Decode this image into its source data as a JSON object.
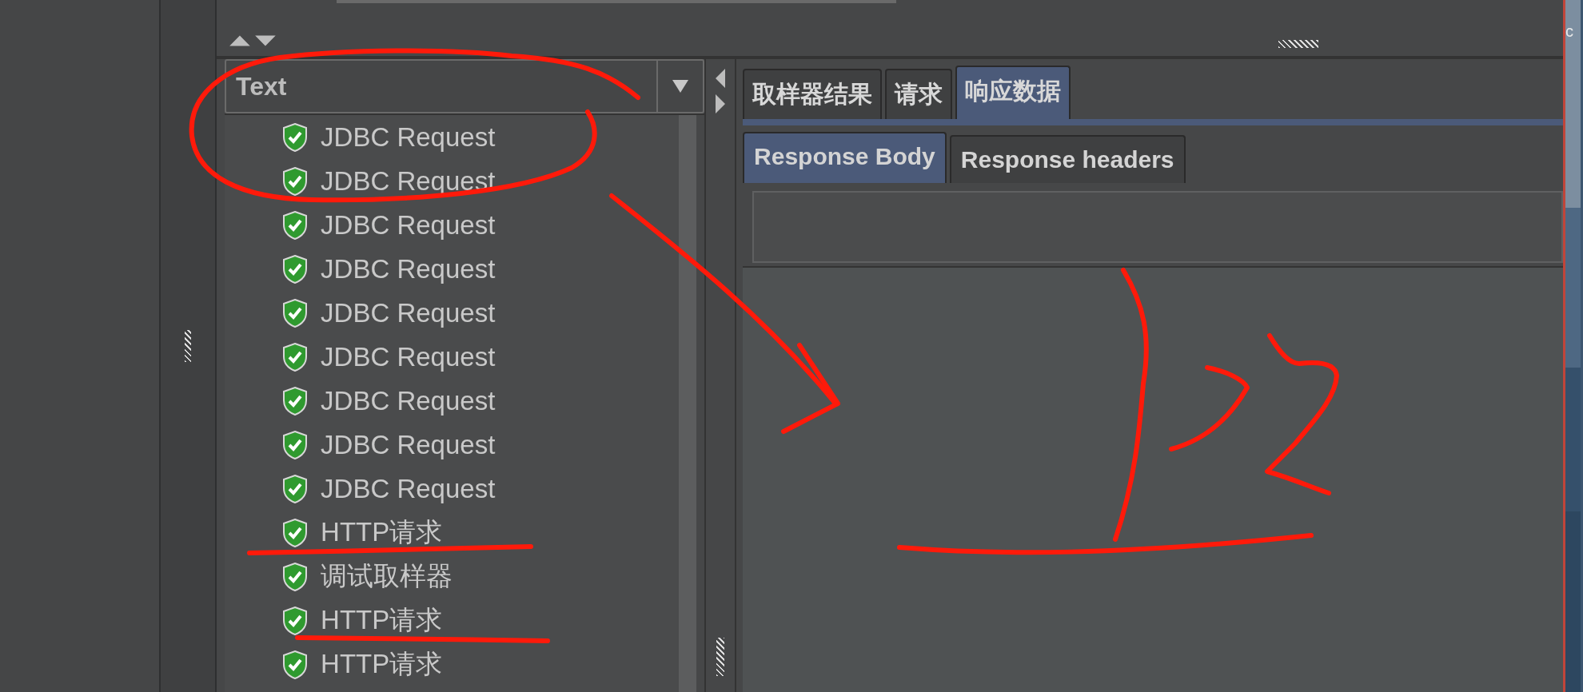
{
  "filter": {
    "value": "Text"
  },
  "results": [
    {
      "label": "JDBC Request"
    },
    {
      "label": "JDBC Request"
    },
    {
      "label": "JDBC Request"
    },
    {
      "label": "JDBC Request"
    },
    {
      "label": "JDBC Request"
    },
    {
      "label": "JDBC Request"
    },
    {
      "label": "JDBC Request"
    },
    {
      "label": "JDBC Request"
    },
    {
      "label": "JDBC Request"
    },
    {
      "label": "HTTP请求"
    },
    {
      "label": "调试取样器"
    },
    {
      "label": "HTTP请求"
    },
    {
      "label": "HTTP请求"
    }
  ],
  "tabs": [
    {
      "label": "取样器结果",
      "selected": false
    },
    {
      "label": "请求",
      "selected": false
    },
    {
      "label": "响应数据",
      "selected": true
    }
  ],
  "response_tabs": [
    {
      "label": "Response Body",
      "selected": true
    },
    {
      "label": "Response headers",
      "selected": false
    }
  ],
  "desktop_text": "c"
}
